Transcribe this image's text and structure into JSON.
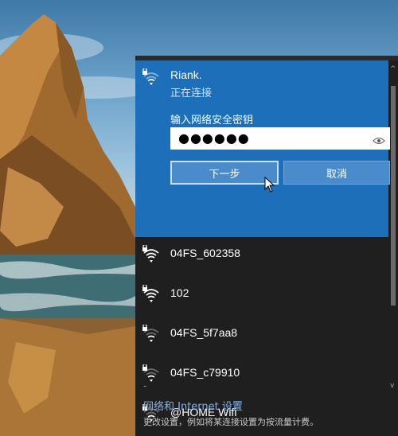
{
  "active_network": {
    "name": "Riank.",
    "status": "正在连接",
    "key_label": "输入网络安全密钥",
    "password_mask": "●●●●●●",
    "next_button": "下一步",
    "cancel_button": "取消"
  },
  "networks": [
    {
      "name": "04FS_602358",
      "icon": "wifi-icon"
    },
    {
      "name": "102",
      "icon": "wifi-icon"
    },
    {
      "name": "04FS_5f7aa8",
      "icon": "wifi-locked-icon"
    },
    {
      "name": "04FS_c79910",
      "icon": "wifi-locked-icon"
    },
    {
      "name": "@HOME Wifi",
      "icon": "wifi-locked-icon"
    }
  ],
  "settings": {
    "dash": "-",
    "link": "网络和 Internet 设置",
    "description": "更改设置，例如将某连接设置为按流量计费。"
  },
  "colors": {
    "accent": "#1e6fba",
    "panel_bg": "#1f1f1f",
    "button_bg": "#4a8ccb",
    "link": "#7fb4ee"
  }
}
